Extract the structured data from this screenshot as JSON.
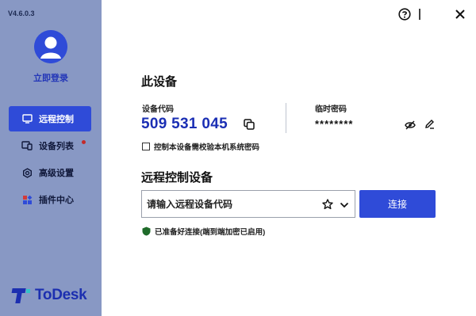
{
  "app": {
    "version": "V4.6.0.3",
    "brand_name": "ToDesk",
    "brand_color": "#1c2fb0",
    "accent": "#2f4bd8",
    "sidebar_bg": "#8898c4"
  },
  "sidebar": {
    "login_label": "立即登录",
    "items": [
      {
        "label": "远程控制",
        "icon": "monitor-icon",
        "active": true
      },
      {
        "label": "设备列表",
        "icon": "device-list-icon",
        "badge": true
      },
      {
        "label": "高级设置",
        "icon": "gear-icon"
      },
      {
        "label": "插件中心",
        "icon": "plugin-grid-icon"
      }
    ]
  },
  "window_controls": {
    "help": "help-icon",
    "minimize": "minimize-icon",
    "close": "close-icon"
  },
  "this_device": {
    "title": "此设备",
    "code_label": "设备代码",
    "code_value": "509 531 045",
    "password_label": "临时密码",
    "password_value": "********",
    "checkbox_label": "控制本设备需校验本机系统密码",
    "checkbox_checked": false
  },
  "remote": {
    "title": "远程控制设备",
    "input_placeholder": "请输入远程设备代码",
    "input_value": "",
    "connect_label": "连接",
    "status_text": "已准备好连接(端到端加密已启用)"
  }
}
